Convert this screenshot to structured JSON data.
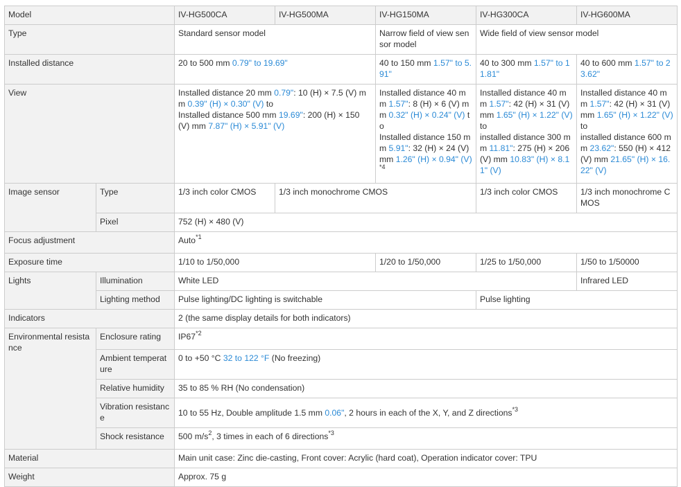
{
  "model": {
    "label": "Model",
    "cols": [
      "IV-HG500CA",
      "IV-HG500MA",
      "IV-HG150MA",
      "IV-HG300CA",
      "IV-HG600MA"
    ]
  },
  "type": {
    "label": "Type",
    "standard": "Standard sensor model",
    "narrow": "Narrow field of view sensor model",
    "wide": "Wide field of view sensor model"
  },
  "installed_distance": {
    "label": "Installed distance",
    "hg500": {
      "a": "20 to 500 mm ",
      "b": "0.79\" to 19.69\""
    },
    "hg150": {
      "a": "40 to 150 mm ",
      "b": "1.57\" to 5.91\""
    },
    "hg300": {
      "a": "40 to 300 mm ",
      "b": "1.57\" to 11.81\""
    },
    "hg600": {
      "a": "40 to 600 mm ",
      "b": "1.57\" to 23.62\""
    }
  },
  "view": {
    "label": "View",
    "hg500": {
      "p1": "Installed distance 20 mm ",
      "b1": "0.79\"",
      "p2": ": 10 (H) × 7.5 (V) mm ",
      "b2": "0.39\" (H) × 0.30\" (V)",
      "p3": " to",
      "p4": "Installed distance 500 mm ",
      "b3": "19.69\"",
      "p5": ": 200 (H) × 150 (V) mm ",
      "b4": "7.87\" (H) × 5.91\" (V)"
    },
    "hg150": {
      "p1": "Installed distance 40 mm ",
      "b1": "1.57\"",
      "p2": ": 8 (H) × 6 (V) mm ",
      "b2": "0.32\" (H) × 0.24\" (V)",
      "p3": " to",
      "p4": "Installed distance 150 mm ",
      "b3": "5.91\"",
      "p5": ": 32 (H) × 24 (V) mm ",
      "b4": "1.26\" (H) × 0.94\" (V)",
      "note": "*4"
    },
    "hg300": {
      "p1": "Installed distance 40 mm ",
      "b1": "1.57\"",
      "p2": ": 42 (H) × 31 (V) mm ",
      "b2": "1.65\" (H) × 1.22\" (V)",
      "p3": " to",
      "p4": "installed distance 300 mm ",
      "b3": "11.81\"",
      "p5": ": 275 (H) × 206 (V) mm ",
      "b4": "10.83\" (H) × 8.11\" (V)"
    },
    "hg600": {
      "p1": "Installed distance 40 mm ",
      "b1": "1.57\"",
      "p2": ": 42 (H) × 31 (V) mm ",
      "b2": "1.65\" (H) × 1.22\" (V)",
      "p3": " to",
      "p4": "installed distance 600 mm ",
      "b3": "23.62\"",
      "p5": ": 550 (H) × 412 (V) mm ",
      "b4": "21.65\" (H) × 16.22\" (V)"
    }
  },
  "image_sensor": {
    "label": "Image sensor",
    "type_label": "Type",
    "color": "1/3 inch color CMOS",
    "mono": "1/3 inch monochrome CMOS",
    "pixel_label": "Pixel",
    "pixel": "752 (H) × 480 (V)"
  },
  "focus": {
    "label": "Focus adjustment",
    "value": "Auto",
    "note": "*1"
  },
  "exposure": {
    "label": "Exposure time",
    "hg500": "1/10 to 1/50,000",
    "hg150": "1/20 to 1/50,000",
    "hg300": "1/25 to 1/50,000",
    "hg600": "1/50 to 1/50000"
  },
  "lights": {
    "label": "Lights",
    "illum_label": "Illumination",
    "white": "White LED",
    "infrared": "Infrared LED",
    "method_label": "Lighting method",
    "switchable": "Pulse lighting/DC lighting is switchable",
    "pulse": "Pulse lighting"
  },
  "indicators": {
    "label": "Indicators",
    "value": "2 (the same display details for both indicators)"
  },
  "env": {
    "label": "Environmental resistance",
    "enclosure": {
      "label": "Enclosure rating",
      "value": "IP67",
      "note": "*2"
    },
    "ambient": {
      "label": "Ambient temperature",
      "a": "0 to +50 °C ",
      "b": "32 to 122 °F",
      "c": " (No freezing)"
    },
    "humidity": {
      "label": "Relative humidity",
      "value": "35 to 85 % RH (No condensation)"
    },
    "vibration": {
      "label": "Vibration resistance",
      "a": "10 to 55 Hz, Double amplitude 1.5 mm ",
      "b": "0.06\"",
      "c": ", 2 hours in each of the X, Y, and Z directions",
      "note": "*3"
    },
    "shock": {
      "label": "Shock resistance",
      "a": "500 m/s",
      "exp": "2",
      "c": ", 3 times in each of 6 directions",
      "note": "*3"
    }
  },
  "material": {
    "label": "Material",
    "value": "Main unit case: Zinc die-casting, Front cover: Acrylic (hard coat), Operation indicator cover: TPU"
  },
  "weight": {
    "label": "Weight",
    "value": "Approx. 75 g"
  },
  "colors": {
    "header_bg": "#f2f2f2",
    "border": "#cccccc",
    "text": "#333333",
    "accent_blue": "#2b8ad6"
  }
}
